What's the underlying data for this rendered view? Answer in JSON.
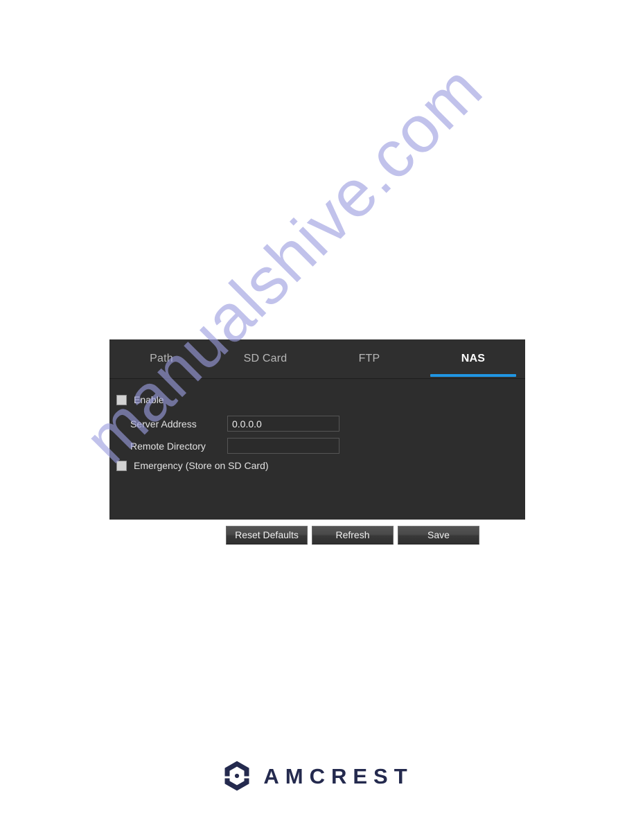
{
  "watermark": {
    "text": "manualshive.com",
    "color": "#9c9ee0"
  },
  "panel": {
    "accent_color": "#2196e3",
    "background_color": "#2d2d2d",
    "tabs": [
      {
        "label": "Path",
        "active": false
      },
      {
        "label": "SD Card",
        "active": false
      },
      {
        "label": "FTP",
        "active": false
      },
      {
        "label": "NAS",
        "active": true
      }
    ],
    "form": {
      "enable": {
        "label": "Enable",
        "checked": false
      },
      "server_address": {
        "label": "Server Address",
        "value": "0.0.0.0",
        "placeholder": ""
      },
      "remote_directory": {
        "label": "Remote Directory",
        "value": "",
        "placeholder": ""
      },
      "emergency": {
        "label": "Emergency (Store on SD Card)",
        "checked": false
      }
    },
    "buttons": {
      "reset": "Reset Defaults",
      "refresh": "Refresh",
      "save": "Save"
    }
  },
  "footer": {
    "brand": "AMCREST",
    "brand_color": "#242a4e"
  }
}
